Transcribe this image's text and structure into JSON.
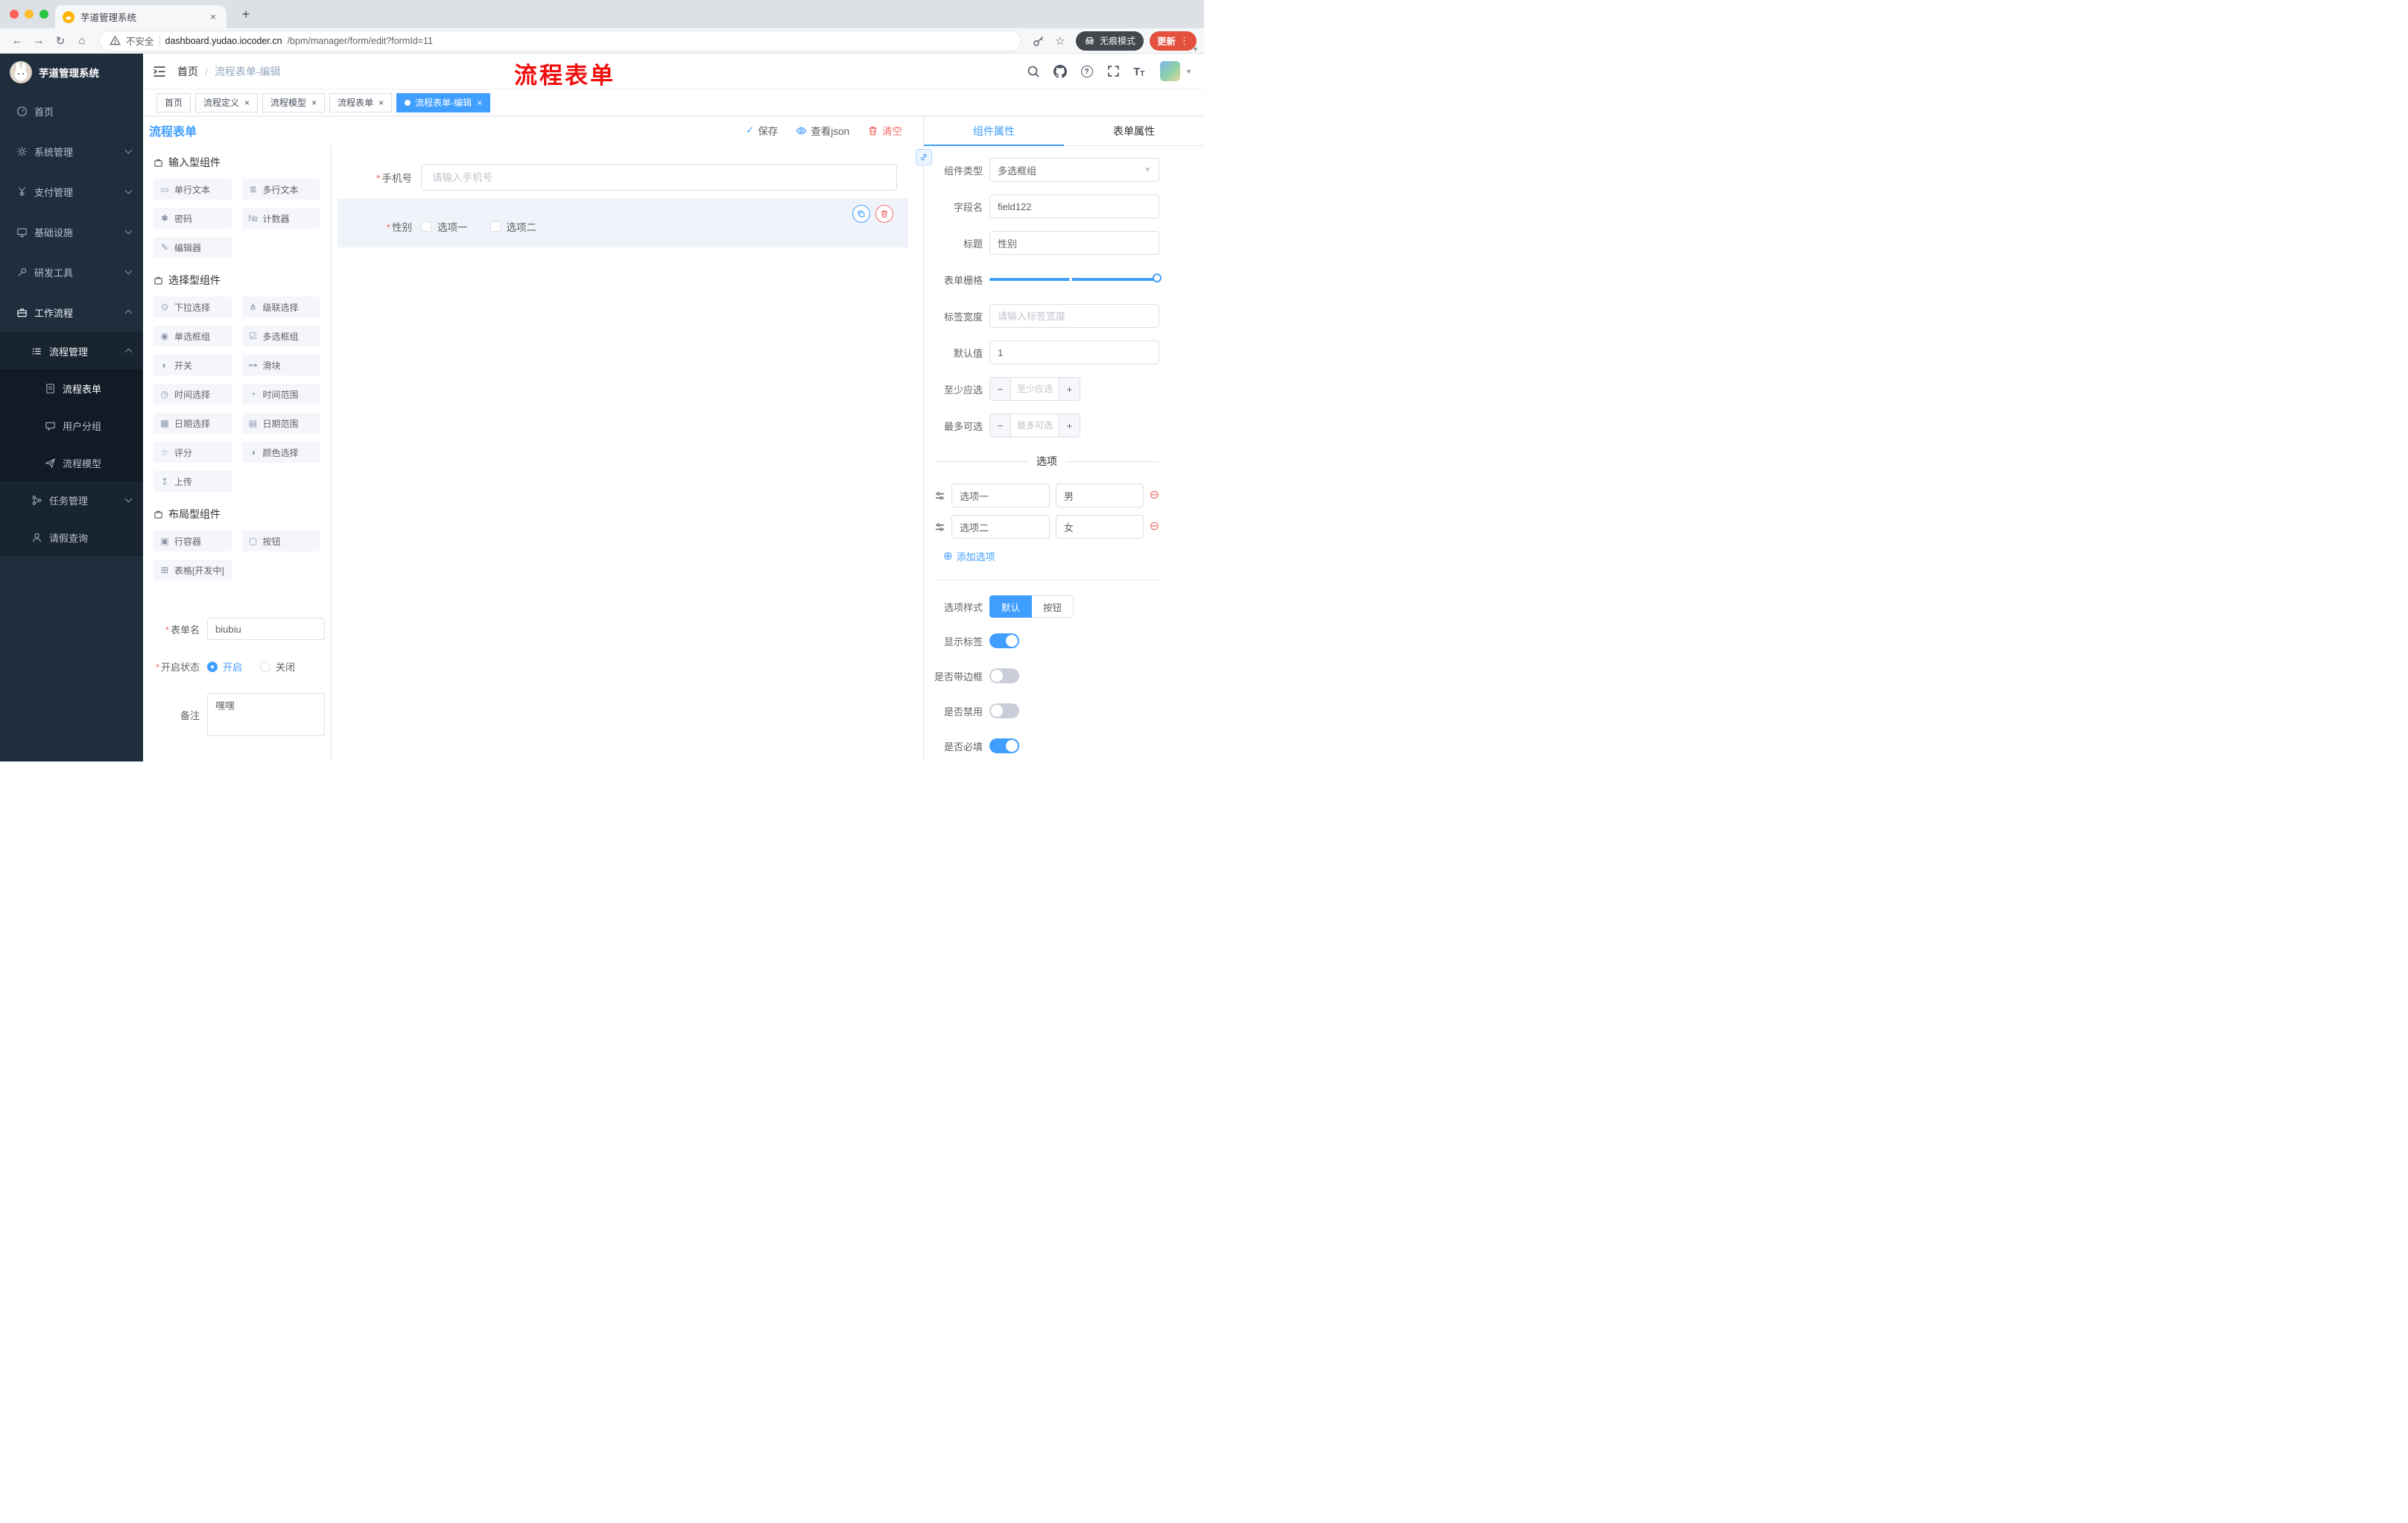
{
  "browser": {
    "tab_title": "芋道管理系统",
    "security_label": "不安全",
    "url_domain": "dashboard.yudao.iocoder.cn",
    "url_path": "/bpm/manager/form/edit?formId=11",
    "incognito_label": "无痕模式",
    "update_label": "更新"
  },
  "sidebar": {
    "logo_title": "芋道管理系统",
    "items": [
      {
        "label": "首页"
      },
      {
        "label": "系统管理"
      },
      {
        "label": "支付管理"
      },
      {
        "label": "基础设施"
      },
      {
        "label": "研发工具"
      },
      {
        "label": "工作流程"
      },
      {
        "label": "流程管理"
      },
      {
        "label": "流程表单"
      },
      {
        "label": "用户分组"
      },
      {
        "label": "流程模型"
      },
      {
        "label": "任务管理"
      },
      {
        "label": "请假查询"
      }
    ]
  },
  "header": {
    "breadcrumb": {
      "home": "首页",
      "sep": "/",
      "current": "流程表单-编辑"
    },
    "annotation": "流程表单"
  },
  "tags": [
    {
      "label": "首页",
      "closable": false,
      "active": false
    },
    {
      "label": "流程定义",
      "closable": true,
      "active": false
    },
    {
      "label": "流程模型",
      "closable": true,
      "active": false
    },
    {
      "label": "流程表单",
      "closable": true,
      "active": false
    },
    {
      "label": "流程表单-编辑",
      "closable": true,
      "active": true
    }
  ],
  "designer": {
    "title": "流程表单",
    "save": "保存",
    "view_json": "查看json",
    "clear": "清空"
  },
  "components": {
    "sections": [
      {
        "title": "输入型组件",
        "items": [
          {
            "label": "单行文本",
            "glyph": "▭"
          },
          {
            "label": "多行文本",
            "glyph": "≣"
          },
          {
            "label": "密码",
            "glyph": "✱"
          },
          {
            "label": "计数器",
            "glyph": "№"
          },
          {
            "label": "编辑器",
            "glyph": "✎"
          }
        ]
      },
      {
        "title": "选择型组件",
        "items": [
          {
            "label": "下拉选择",
            "glyph": "⊙"
          },
          {
            "label": "级联选择",
            "glyph": "⋔"
          },
          {
            "label": "单选框组",
            "glyph": "◉"
          },
          {
            "label": "多选框组",
            "glyph": "☑"
          },
          {
            "label": "开关",
            "glyph": "◐"
          },
          {
            "label": "滑块",
            "glyph": "⊶"
          },
          {
            "label": "时间选择",
            "glyph": "◷"
          },
          {
            "label": "时间范围",
            "glyph": "◔"
          },
          {
            "label": "日期选择",
            "glyph": "▦"
          },
          {
            "label": "日期范围",
            "glyph": "▤"
          },
          {
            "label": "评分",
            "glyph": "☆"
          },
          {
            "label": "颜色选择",
            "glyph": "◑"
          },
          {
            "label": "上传",
            "glyph": "↥"
          }
        ]
      },
      {
        "title": "布局型组件",
        "items": [
          {
            "label": "行容器",
            "glyph": "▣"
          },
          {
            "label": "按钮",
            "glyph": "▢"
          },
          {
            "label": "表格[开发中]",
            "glyph": "⊞"
          }
        ]
      }
    ],
    "form_name_label": "表单名",
    "form_name_value": "biubiu",
    "status_label": "开启状态",
    "status_on": "开启",
    "status_off": "关闭",
    "remark_label": "备注",
    "remark_value": "嘿嘿"
  },
  "canvas": {
    "phone_label": "手机号",
    "phone_placeholder": "请输入手机号",
    "gender_label": "性别",
    "gender_options": [
      "选项一",
      "选项二"
    ]
  },
  "props": {
    "tabs": [
      "组件属性",
      "表单属性"
    ],
    "type_label": "组件类型",
    "type_value": "多选框组",
    "field_label": "字段名",
    "field_value": "field122",
    "title_label": "标题",
    "title_value": "性别",
    "grid_label": "表单栅格",
    "width_label": "标签宽度",
    "width_placeholder": "请输入标签宽度",
    "default_label": "默认值",
    "default_value": "1",
    "min_label": "至少应选",
    "min_placeholder": "至少应选",
    "max_label": "最多可选",
    "max_placeholder": "最多可选",
    "divider": "选项",
    "options": [
      {
        "label": "选项一",
        "value": "男"
      },
      {
        "label": "选项二",
        "value": "女"
      }
    ],
    "add_option": "添加选项",
    "style_label": "选项样式",
    "style_default": "默认",
    "style_button": "按钮",
    "switches": [
      {
        "label": "显示标签",
        "on": true
      },
      {
        "label": "是否带边框",
        "on": false
      },
      {
        "label": "是否禁用",
        "on": false
      },
      {
        "label": "是否必填",
        "on": true
      }
    ]
  },
  "colors": {
    "accent": "#409eff",
    "danger": "#f56c6c",
    "annotation_red": "#f20d0d",
    "sidebar_bg": "#1f2d3d",
    "active_tag_bg": "#409eff"
  }
}
